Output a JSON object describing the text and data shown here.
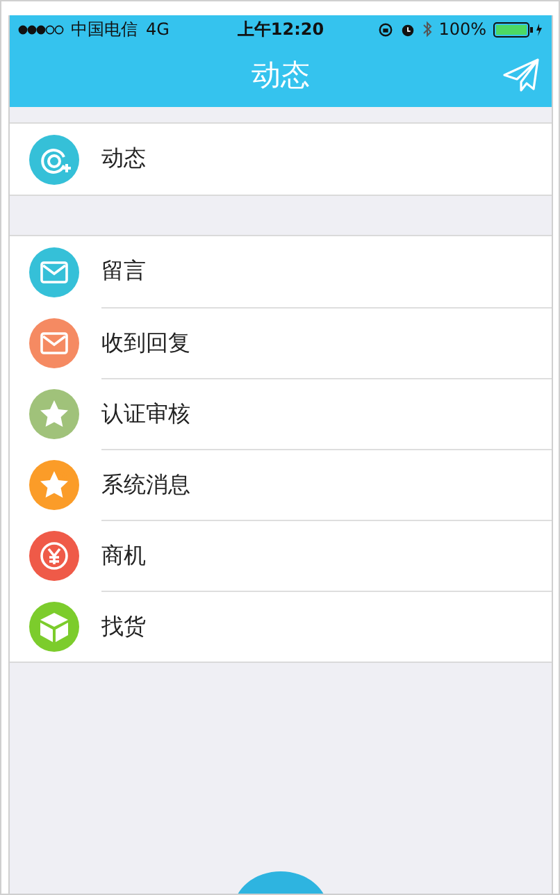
{
  "status_bar": {
    "carrier": "中国电信",
    "network": "4G",
    "time": "上午12:20",
    "battery": "100%"
  },
  "nav": {
    "title": "动态"
  },
  "sections": [
    {
      "items": [
        {
          "label": "动态",
          "kind": "at",
          "color": "#35c0d8"
        }
      ]
    },
    {
      "items": [
        {
          "label": "留言",
          "kind": "mail",
          "color": "#35c0d8"
        },
        {
          "label": "收到回复",
          "kind": "mail",
          "color": "#f58a62"
        },
        {
          "label": "认证审核",
          "kind": "star",
          "color": "#a0c27a"
        },
        {
          "label": "系统消息",
          "kind": "star",
          "color": "#fb9c28"
        },
        {
          "label": "商机",
          "kind": "yen",
          "color": "#ef5a48"
        },
        {
          "label": "找货",
          "kind": "box",
          "color": "#7ccc2c"
        }
      ]
    }
  ]
}
